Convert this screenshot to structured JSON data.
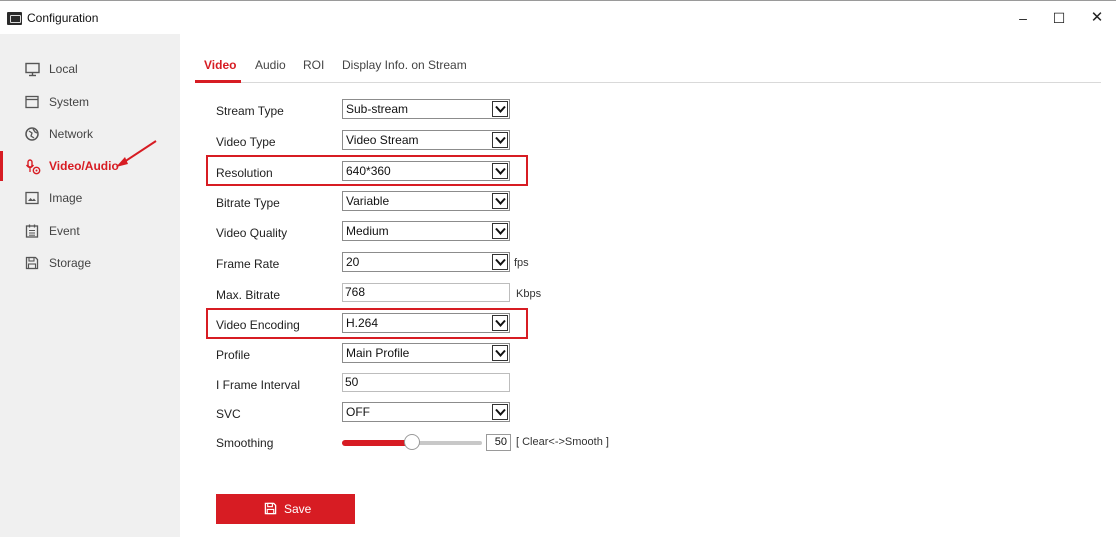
{
  "window": {
    "title": "Configuration",
    "minimize": "–",
    "maximize": "☐",
    "close": "✕"
  },
  "sidebar": {
    "items": [
      {
        "label": "Local",
        "icon": "monitor-icon"
      },
      {
        "label": "System",
        "icon": "window-icon"
      },
      {
        "label": "Network",
        "icon": "globe-icon"
      },
      {
        "label": "Video/Audio",
        "icon": "microphone-icon",
        "active": true
      },
      {
        "label": "Image",
        "icon": "picture-icon"
      },
      {
        "label": "Event",
        "icon": "calendar-icon"
      },
      {
        "label": "Storage",
        "icon": "save-icon"
      }
    ]
  },
  "tabs": [
    {
      "label": "Video",
      "active": true
    },
    {
      "label": "Audio"
    },
    {
      "label": "ROI"
    },
    {
      "label": "Display Info. on Stream"
    }
  ],
  "form": {
    "stream_type": {
      "label": "Stream Type",
      "value": "Sub-stream"
    },
    "video_type": {
      "label": "Video Type",
      "value": "Video Stream"
    },
    "resolution": {
      "label": "Resolution",
      "value": "640*360"
    },
    "bitrate_type": {
      "label": "Bitrate Type",
      "value": "Variable"
    },
    "video_quality": {
      "label": "Video Quality",
      "value": "Medium"
    },
    "frame_rate": {
      "label": "Frame Rate",
      "value": "20",
      "unit": "fps"
    },
    "max_bitrate": {
      "label": "Max. Bitrate",
      "value": "768",
      "unit": "Kbps"
    },
    "video_encoding": {
      "label": "Video Encoding",
      "value": "H.264"
    },
    "profile": {
      "label": "Profile",
      "value": "Main Profile"
    },
    "i_frame_interval": {
      "label": "I Frame Interval",
      "value": "50"
    },
    "svc": {
      "label": "SVC",
      "value": "OFF"
    },
    "smoothing": {
      "label": "Smoothing",
      "value": "50",
      "hint": "[ Clear<->Smooth ]",
      "level_percent": 50
    }
  },
  "save": {
    "label": "Save"
  },
  "colors": {
    "accent": "#d71c23",
    "sidebar_bg": "#f0f0f0"
  }
}
